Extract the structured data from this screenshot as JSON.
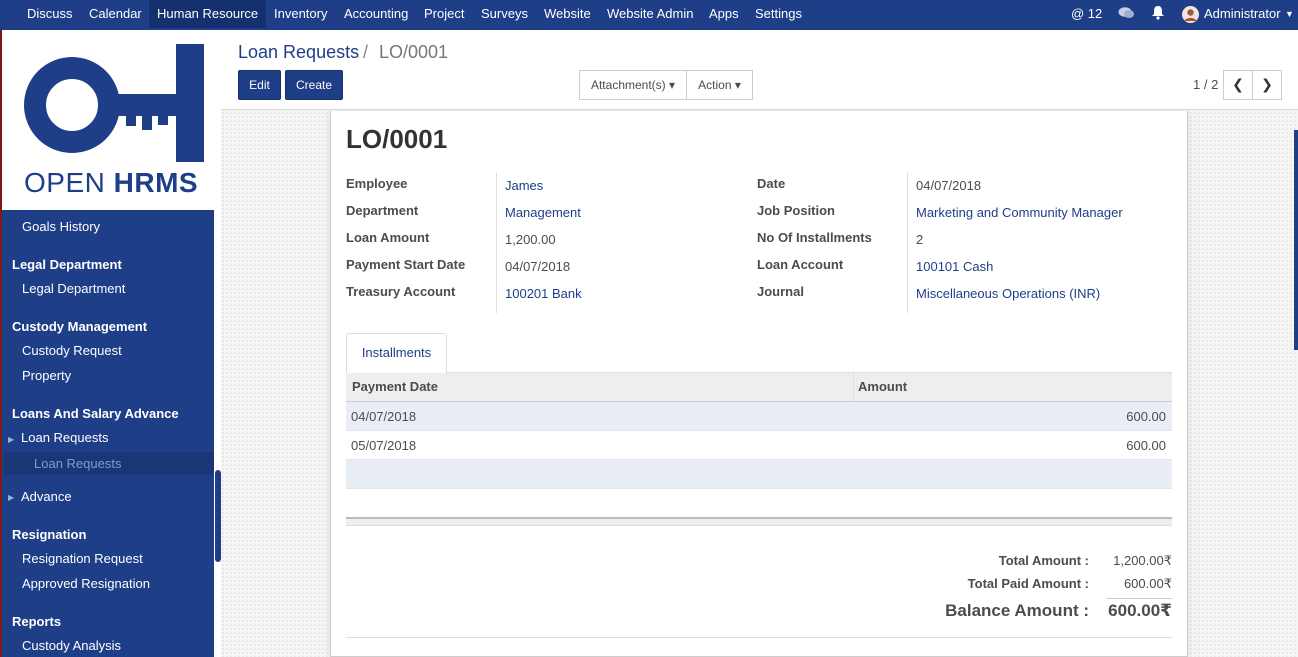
{
  "topbar": {
    "menu": [
      "Discuss",
      "Calendar",
      "Human Resource",
      "Inventory",
      "Accounting",
      "Project",
      "Surveys",
      "Website",
      "Website Admin",
      "Apps",
      "Settings"
    ],
    "mentions_count": "@ 12",
    "user": "Administrator"
  },
  "logo": {
    "open": "OPEN",
    "hrms": "HRMS"
  },
  "sidebar": {
    "goals_history": "Goals History",
    "legal_head": "Legal Department",
    "legal_item": "Legal Department",
    "custody_head": "Custody Management",
    "custody_request": "Custody Request",
    "property": "Property",
    "loans_head": "Loans And Salary Advance",
    "loan_requests": "Loan Requests",
    "loan_requests_sub": "Loan Requests",
    "advance": "Advance",
    "resignation_head": "Resignation",
    "resignation_request": "Resignation Request",
    "approved_resignation": "Approved Resignation",
    "reports_head": "Reports",
    "custody_analysis": "Custody Analysis"
  },
  "control": {
    "breadcrumb_parent": "Loan Requests",
    "breadcrumb_sep": "/",
    "breadcrumb_current": "LO/0001",
    "edit": "Edit",
    "create": "Create",
    "attachments": "Attachment(s) ▾",
    "action": "Action ▾",
    "pager": "1 / 2"
  },
  "record": {
    "title": "LO/0001",
    "fields_left": [
      {
        "label": "Employee",
        "value": "James"
      },
      {
        "label": "Department",
        "value": "Management"
      },
      {
        "label": "Loan Amount",
        "value": "1,200.00"
      },
      {
        "label": "Payment Start Date",
        "value": "04/07/2018"
      },
      {
        "label": "Treasury Account",
        "value": "100201 Bank"
      }
    ],
    "fields_right": [
      {
        "label": "Date",
        "value": "04/07/2018"
      },
      {
        "label": "Job Position",
        "value": "Marketing and Community Manager"
      },
      {
        "label": "No Of Installments",
        "value": "2"
      },
      {
        "label": "Loan Account",
        "value": "100101 Cash"
      },
      {
        "label": "Journal",
        "value": "Miscellaneous Operations (INR)"
      }
    ]
  },
  "installments": {
    "tab": "Installments",
    "columns": [
      "Payment Date",
      "Amount"
    ],
    "rows": [
      {
        "date": "04/07/2018",
        "amount": "600.00"
      },
      {
        "date": "05/07/2018",
        "amount": "600.00"
      }
    ]
  },
  "totals": {
    "total_label": "Total Amount :",
    "total_value": "1,200.00₹",
    "paid_label": "Total Paid Amount :",
    "paid_value": "600.00₹",
    "balance_label": "Balance Amount :",
    "balance_value": "600.00₹"
  },
  "colors": {
    "brand": "#1f3e88",
    "link": "#1f3e88"
  }
}
